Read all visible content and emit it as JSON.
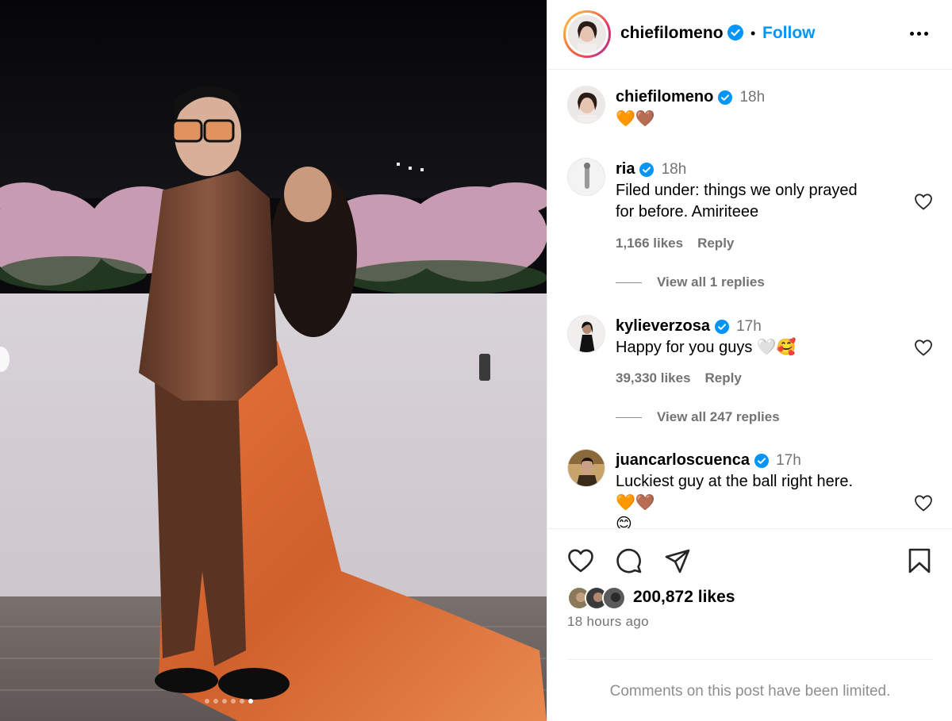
{
  "post": {
    "author": "chiefilomeno",
    "follow_label": "Follow",
    "separator": "•",
    "more_icon": "more-horizontal-icon",
    "carousel": {
      "slide_count": 6,
      "active_index": 5
    }
  },
  "comments": [
    {
      "username": "chiefilomeno",
      "verified": true,
      "time": "18h",
      "text": "🧡🤎",
      "likes": "",
      "reply_label": ""
    },
    {
      "username": "ria",
      "verified": true,
      "time": "18h",
      "text_lines": [
        "Filed under: things we only prayed",
        "for before. Amiriteee"
      ],
      "likes": "1,166 likes",
      "reply_label": "Reply",
      "view_replies": "View all 1 replies"
    },
    {
      "username": "kylieverzosa",
      "verified": true,
      "time": "17h",
      "text": "Happy for you guys 🤍🥰",
      "likes": "39,330 likes",
      "reply_label": "Reply",
      "view_replies": "View all 247 replies"
    },
    {
      "username": "juancarloscuenca",
      "verified": true,
      "time": "17h",
      "text_lines": [
        "Luckiest guy at the ball right here.",
        "🧡🤎",
        "😊"
      ]
    }
  ],
  "footer": {
    "likes": "200,872 likes",
    "time_ago": "18 hours ago",
    "limited_notice": "Comments on this post have been limited.",
    "icons": [
      "heart-icon",
      "comment-icon",
      "share-icon",
      "bookmark-icon"
    ]
  },
  "colors": {
    "link_blue": "#0095f6",
    "verified_blue": "#0095f6",
    "muted": "#737373"
  }
}
